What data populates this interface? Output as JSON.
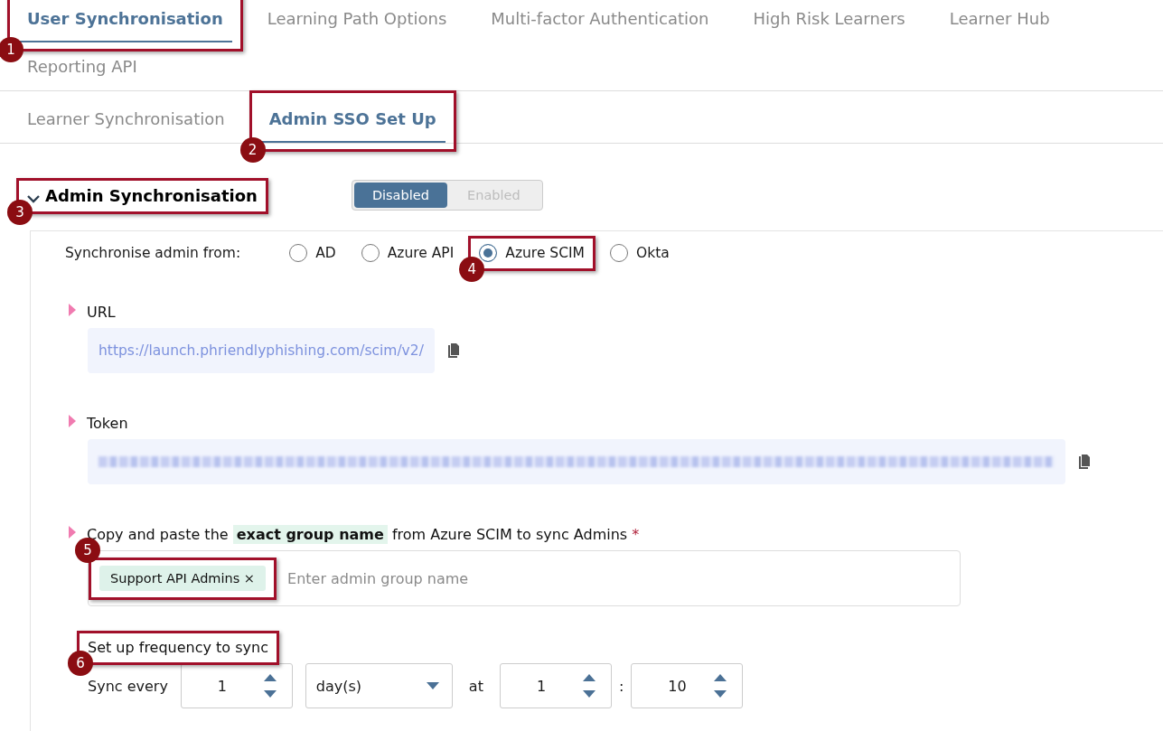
{
  "top_tabs": [
    {
      "label": "User Synchronisation",
      "selected": true,
      "callout": "1"
    },
    {
      "label": "Learning Path Options",
      "selected": false
    },
    {
      "label": "Multi-factor Authentication",
      "selected": false
    },
    {
      "label": "High Risk Learners",
      "selected": false
    },
    {
      "label": "Learner Hub",
      "selected": false
    },
    {
      "label": "Reporting API",
      "selected": false
    }
  ],
  "sub_tabs": [
    {
      "label": "Learner Synchronisation",
      "selected": false
    },
    {
      "label": "Admin SSO Set Up",
      "selected": true,
      "callout": "2"
    }
  ],
  "section": {
    "title": "Admin Synchronisation",
    "expanded": true,
    "callout": "3",
    "toggle": [
      {
        "label": "Disabled",
        "selected": true
      },
      {
        "label": "Enabled",
        "selected": false
      }
    ]
  },
  "source": {
    "label": "Synchronise admin from:",
    "options": [
      {
        "label": "AD",
        "selected": false
      },
      {
        "label": "Azure API",
        "selected": false
      },
      {
        "label": "Azure SCIM",
        "selected": true,
        "callout": "4"
      },
      {
        "label": "Okta",
        "selected": false
      }
    ]
  },
  "url": {
    "label": "URL",
    "value": "https://launch.phriendlyphishing.com/scim/v2/"
  },
  "token": {
    "label": "Token"
  },
  "group": {
    "label_before": "Copy and paste the",
    "highlight": "exact group name",
    "label_after": "from Azure SCIM to sync Admins",
    "required": "*",
    "tags": [
      {
        "label": "Support API Admins",
        "remove": "×",
        "callout": "5"
      }
    ],
    "placeholder": "Enter admin group name"
  },
  "frequency": {
    "label": "Set up frequency to sync",
    "callout": "6",
    "sync_label": "Sync every",
    "interval": "1",
    "unit": "day(s)",
    "at_label": "at",
    "hour": "1",
    "separator": ":",
    "minute": "10"
  }
}
